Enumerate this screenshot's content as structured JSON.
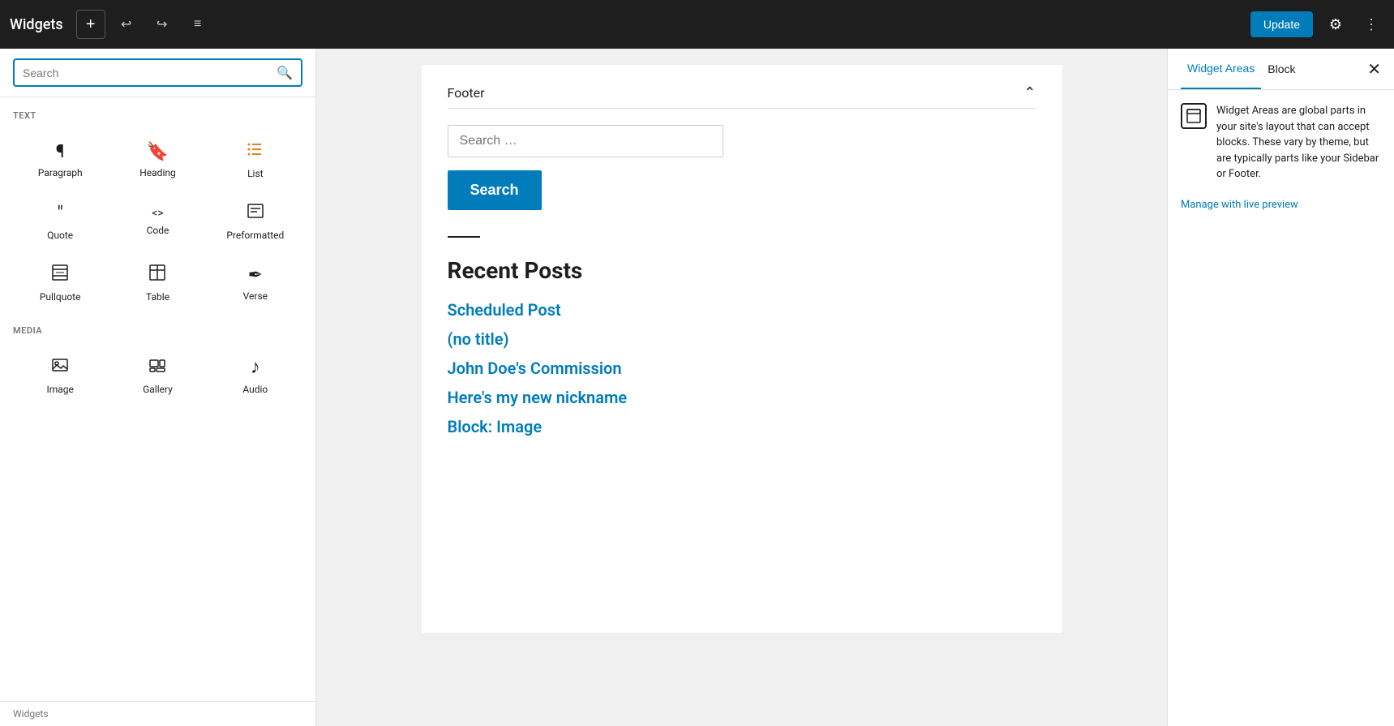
{
  "topbar": {
    "title": "Widgets",
    "add_label": "+",
    "update_label": "Update",
    "icons": {
      "undo": "↩",
      "redo": "↪",
      "list": "≡",
      "gear": "⚙",
      "more": "⋮"
    }
  },
  "left_panel": {
    "search_placeholder": "Search",
    "sections": [
      {
        "label": "TEXT",
        "blocks": [
          {
            "icon": "¶",
            "label": "Paragraph",
            "color": "normal"
          },
          {
            "icon": "🔖",
            "label": "Heading",
            "color": "heading"
          },
          {
            "icon": "≡",
            "label": "List",
            "color": "list"
          },
          {
            "icon": "❝",
            "label": "Quote",
            "color": "normal"
          },
          {
            "icon": "<>",
            "label": "Code",
            "color": "normal"
          },
          {
            "icon": "⊟",
            "label": "Preformatted",
            "color": "normal"
          },
          {
            "icon": "❞",
            "label": "Pullquote",
            "color": "normal"
          },
          {
            "icon": "⊞",
            "label": "Table",
            "color": "normal"
          },
          {
            "icon": "✒",
            "label": "Verse",
            "color": "normal"
          }
        ]
      },
      {
        "label": "MEDIA",
        "blocks": [
          {
            "icon": "🖼",
            "label": "Image",
            "color": "normal"
          },
          {
            "icon": "⊟",
            "label": "Gallery",
            "color": "normal"
          },
          {
            "icon": "♪",
            "label": "Audio",
            "color": "normal"
          }
        ]
      }
    ]
  },
  "status_bar": {
    "label": "Widgets"
  },
  "center": {
    "footer_title": "Footer",
    "search_placeholder": "Search …",
    "search_button": "Search",
    "recent_posts_title": "Recent Posts",
    "posts": [
      {
        "title": "Scheduled Post"
      },
      {
        "title": "(no title)"
      },
      {
        "title": "John Doe's Commission"
      },
      {
        "title": "Here's my new nickname"
      },
      {
        "title": "Block: Image"
      }
    ]
  },
  "right_panel": {
    "tab_widget_areas": "Widget Areas",
    "tab_block": "Block",
    "close_icon": "✕",
    "info_text": "Widget Areas are global parts in your site's layout that can accept blocks. These vary by theme, but are typically parts like your Sidebar or Footer.",
    "manage_link": "Manage with live preview"
  }
}
